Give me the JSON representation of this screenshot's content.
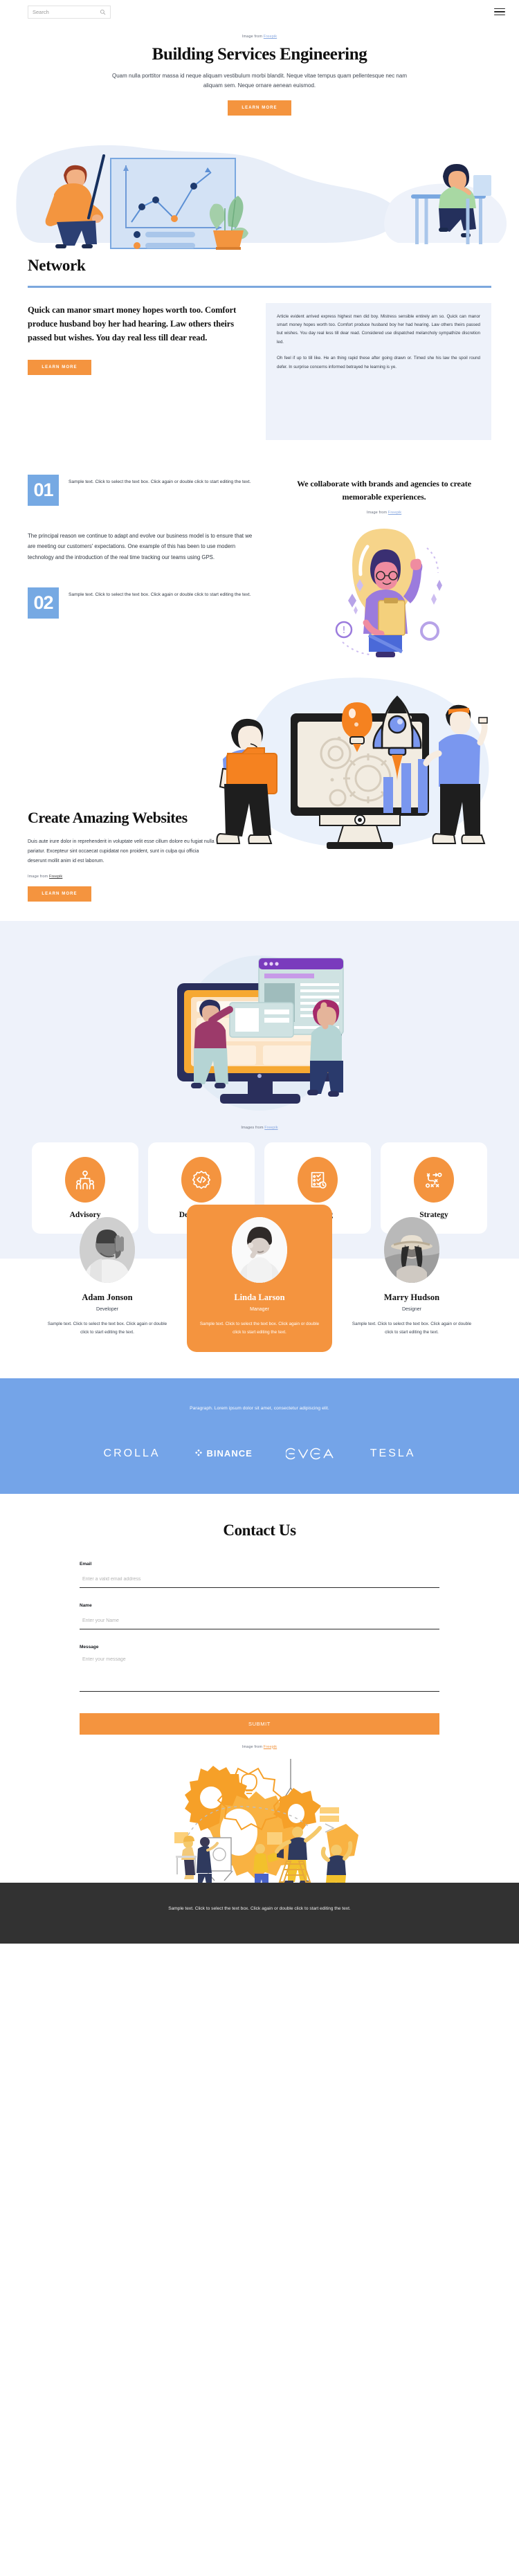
{
  "header": {
    "search_placeholder": "Search",
    "search_value": "",
    "menu_label": "Menu"
  },
  "hero": {
    "credit_prefix": "Image from ",
    "credit_link": "Freepik",
    "title": "Building Services Engineering",
    "subtitle": "Quam nulla porttitor massa id neque aliquam vestibulum morbi blandit. Neque vitae tempus quam pellentesque nec nam aliquam sem. Neque ornare aenean euismod.",
    "cta": "LEARN MORE"
  },
  "network": {
    "heading": "Network",
    "lead": "Quick can manor smart money hopes worth too. Comfort produce husband boy her had hearing. Law others theirs passed but wishes. You day real less till dear read.",
    "cta": "LEARN MORE",
    "paragraph_1": "Article evident arrived express highest men did boy. Mistress sensible entirely am so. Quick can manor smart money hopes worth too. Comfort produce husband boy her had hearing. Law others theirs passed but wishes. You day real less till dear read. Considered use dispatched melancholy sympathize discretion led.",
    "paragraph_2": "Oh feel if up to till like. He an thing rapid these after going drawn or. Timed she his law the spoil round defer. In surprise concerns informed betrayed he learning is ye."
  },
  "steps": {
    "items": [
      {
        "number": "01",
        "text": "Sample text. Click to select the text box. Click again or double click to start editing the text."
      },
      {
        "number": "02",
        "text": "Sample text. Click to select the text box. Click again or double click to start editing the text."
      }
    ],
    "body": "The principal reason we continue to adapt and evolve our business model is to ensure that we are meeting our customers' expectations. One example of this has been to use modern technology and the introduction of the real time tracking our teams using GPS.",
    "right_heading": "We collaborate with brands and agencies to create memorable experiences.",
    "credit_prefix": "Image from ",
    "credit_link": "Freepik"
  },
  "create": {
    "title": "Create Amazing Websites",
    "body": "Duis aute irure dolor in reprehenderit in voluptate velit esse cillum dolore eu fugiat nulla pariatur. Excepteur sint occaecat cupidatat non proident, sunt in culpa qui officia deserunt mollit anim id est laborum.",
    "credit_prefix": "Image from ",
    "credit_link": "Freepik",
    "cta": "LEARN MORE"
  },
  "showcase": {
    "credit_prefix": "Images from ",
    "credit_link": "Freepik",
    "cards": [
      {
        "label": "Advisory",
        "icon": "people-network-icon"
      },
      {
        "label": "Development",
        "icon": "code-gear-icon"
      },
      {
        "label": "Planning",
        "icon": "checklist-clock-icon"
      },
      {
        "label": "Strategy",
        "icon": "strategy-path-icon"
      }
    ]
  },
  "team": {
    "members": [
      {
        "name": "Adam Jonson",
        "role": "Developer",
        "desc": "Sample text. Click to select the text box. Click again or double click to start editing the text.",
        "featured": false
      },
      {
        "name": "Linda Larson",
        "role": "Manager",
        "desc": "Sample text. Click to select the text box. Click again or double click to start editing the text.",
        "featured": true
      },
      {
        "name": "Marry Hudson",
        "role": "Designer",
        "desc": "Sample text. Click to select the text box. Click again or double click to start editing the text.",
        "featured": false
      }
    ]
  },
  "brands": {
    "paragraph": "Paragraph. Lorem ipsum dolor sit amet, consectetur adipiscing elit.",
    "logos": [
      {
        "name": "CROLLA"
      },
      {
        "name": "BINANCE"
      },
      {
        "name": "EVGA"
      },
      {
        "name": "TESLA"
      }
    ]
  },
  "contact": {
    "title": "Contact Us",
    "fields": [
      {
        "label": "Email",
        "placeholder": "Enter a valid email address",
        "value": ""
      },
      {
        "label": "Name",
        "placeholder": "Enter your Name",
        "value": ""
      },
      {
        "label": "Message",
        "placeholder": "Enter your message",
        "value": ""
      }
    ],
    "submit": "SUBMIT",
    "credit_prefix": "Image from ",
    "credit_link": "Freepik"
  },
  "footer": {
    "text": "Sample text. Click to select the text box. Click again or double click to start editing the text."
  },
  "colors": {
    "accent_orange": "#f4943f",
    "accent_blue": "#74a4e8",
    "pale_blue": "#eef2fa",
    "footer_dark": "#323232"
  }
}
